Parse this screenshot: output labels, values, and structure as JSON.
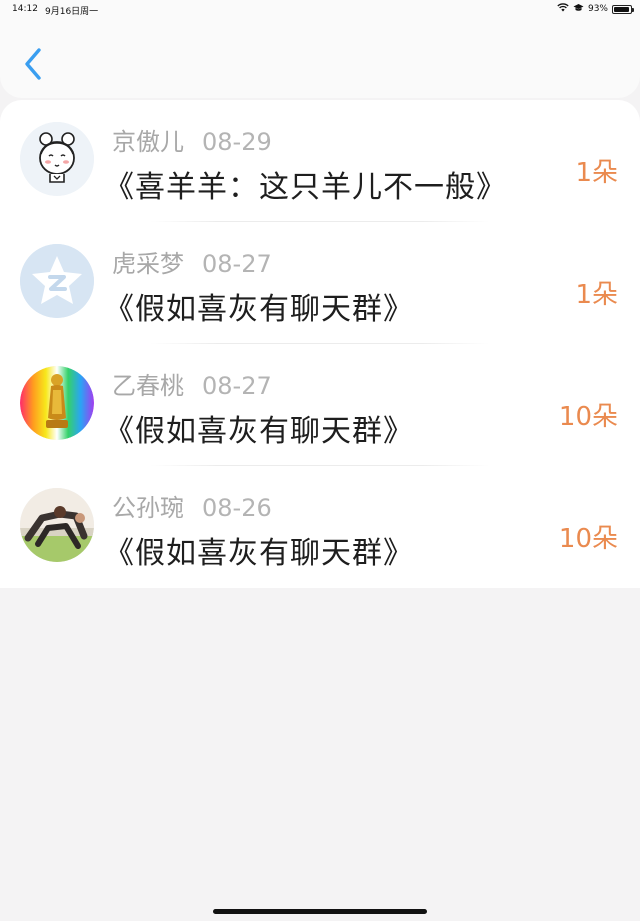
{
  "status_bar": {
    "time": "14:12",
    "date": "9月16日周一",
    "battery": "93%",
    "battery_level": 0.93
  },
  "nav": {
    "back_icon": "chevron-left-icon",
    "accent_color": "#3a9ef0"
  },
  "items": [
    {
      "user": "京傲儿",
      "date": "08-29",
      "title": "《喜羊羊：这只羊儿不一般》",
      "count": "1朵",
      "avatar": "cartoon-girl-avatar"
    },
    {
      "user": "虎采梦",
      "date": "08-27",
      "title": "《假如喜灰有聊天群》",
      "count": "1朵",
      "avatar": "qq-default-avatar"
    },
    {
      "user": "乙春桃",
      "date": "08-27",
      "title": "《假如喜灰有聊天群》",
      "count": "10朵",
      "avatar": "buddha-rainbow-avatar"
    },
    {
      "user": "公孙琬",
      "date": "08-26",
      "title": "《假如喜灰有聊天群》",
      "count": "10朵",
      "avatar": "yoga-photo-avatar"
    }
  ],
  "colors": {
    "count": "#ea8a4f",
    "name": "#a8a8a8",
    "title": "#1e1e1e",
    "background": "#f4f3f4"
  }
}
